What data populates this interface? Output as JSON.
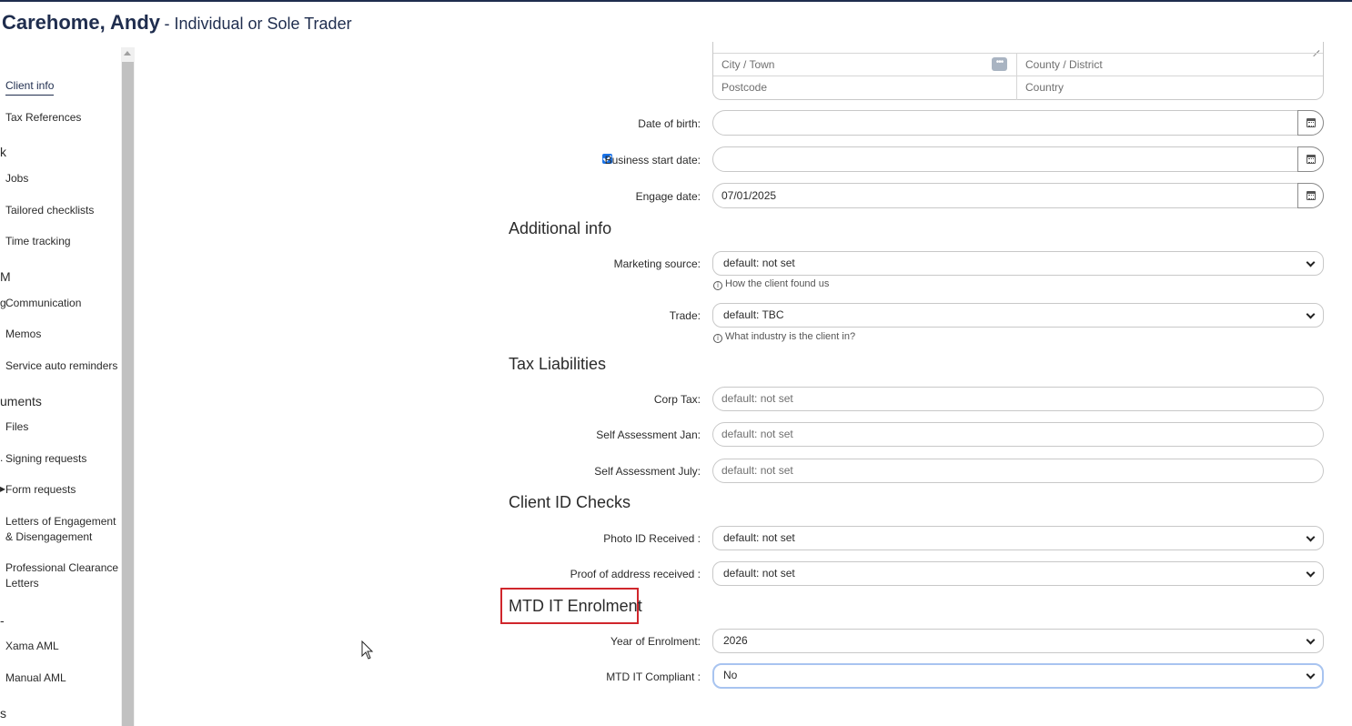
{
  "header": {
    "client_name": "Carehome, Andy",
    "client_type": "- Individual or Sole Trader"
  },
  "sidebar": {
    "items": [
      {
        "label": "Client info",
        "active": true
      },
      {
        "label": "Tax References"
      },
      {
        "section": "k"
      },
      {
        "label": "Jobs"
      },
      {
        "label": "Tailored checklists"
      },
      {
        "label": "Time tracking"
      },
      {
        "section": "M"
      },
      {
        "label": "Communication"
      },
      {
        "label": "Memos"
      },
      {
        "label": "Service auto reminders"
      },
      {
        "section": "uments"
      },
      {
        "label": "Files"
      },
      {
        "label": "Signing requests"
      },
      {
        "label": "Form requests"
      },
      {
        "label": "Letters of Engagement"
      },
      {
        "label": "& Disengagement"
      },
      {
        "label": "Professional Clearance"
      },
      {
        "label": "Letters"
      },
      {
        "section": "-"
      },
      {
        "label": "Xama AML"
      },
      {
        "label": "Manual AML"
      },
      {
        "section": "s"
      }
    ]
  },
  "address": {
    "city_placeholder": "City / Town",
    "county_placeholder": "County / District",
    "postcode_placeholder": "Postcode",
    "country_placeholder": "Country",
    "lookup_glyph": "•••"
  },
  "dates": {
    "dob_label": "Date of birth:",
    "dob_value": "",
    "business_start_label": "Business start date:",
    "business_start_checked": true,
    "business_start_value": "",
    "engage_label": "Engage date:",
    "engage_value": "07/01/2025"
  },
  "additional_info": {
    "heading": "Additional info",
    "marketing_label": "Marketing source:",
    "marketing_value": "default: not set",
    "marketing_hint": "How the client found us",
    "trade_label": "Trade:",
    "trade_value": "default: TBC",
    "trade_hint": "What industry is the client in?"
  },
  "tax_liabilities": {
    "heading": "Tax Liabilities",
    "corp_label": "Corp Tax:",
    "corp_placeholder": "default: not set",
    "sa_jan_label": "Self Assessment Jan:",
    "sa_jan_placeholder": "default: not set",
    "sa_july_label": "Self Assessment July:",
    "sa_july_placeholder": "default: not set"
  },
  "id_checks": {
    "heading": "Client ID Checks",
    "photo_label": "Photo ID Received :",
    "photo_value": "default: not set",
    "proof_label": "Proof of address received :",
    "proof_value": "default: not set"
  },
  "mtd": {
    "heading": "MTD IT Enrolment",
    "year_label": "Year of Enrolment:",
    "year_value": "2026",
    "compliant_label": "MTD IT Compliant :",
    "compliant_value": "No"
  },
  "icons": {
    "info": "ⓘ",
    "calendar": "calendar-icon",
    "chevron": "chevron-down-icon"
  },
  "colors": {
    "brand_navy": "#1f2d4e",
    "highlight_red": "#d0262c",
    "focus_blue": "#a8c4f0",
    "checkbox_blue": "#1a73e8"
  }
}
